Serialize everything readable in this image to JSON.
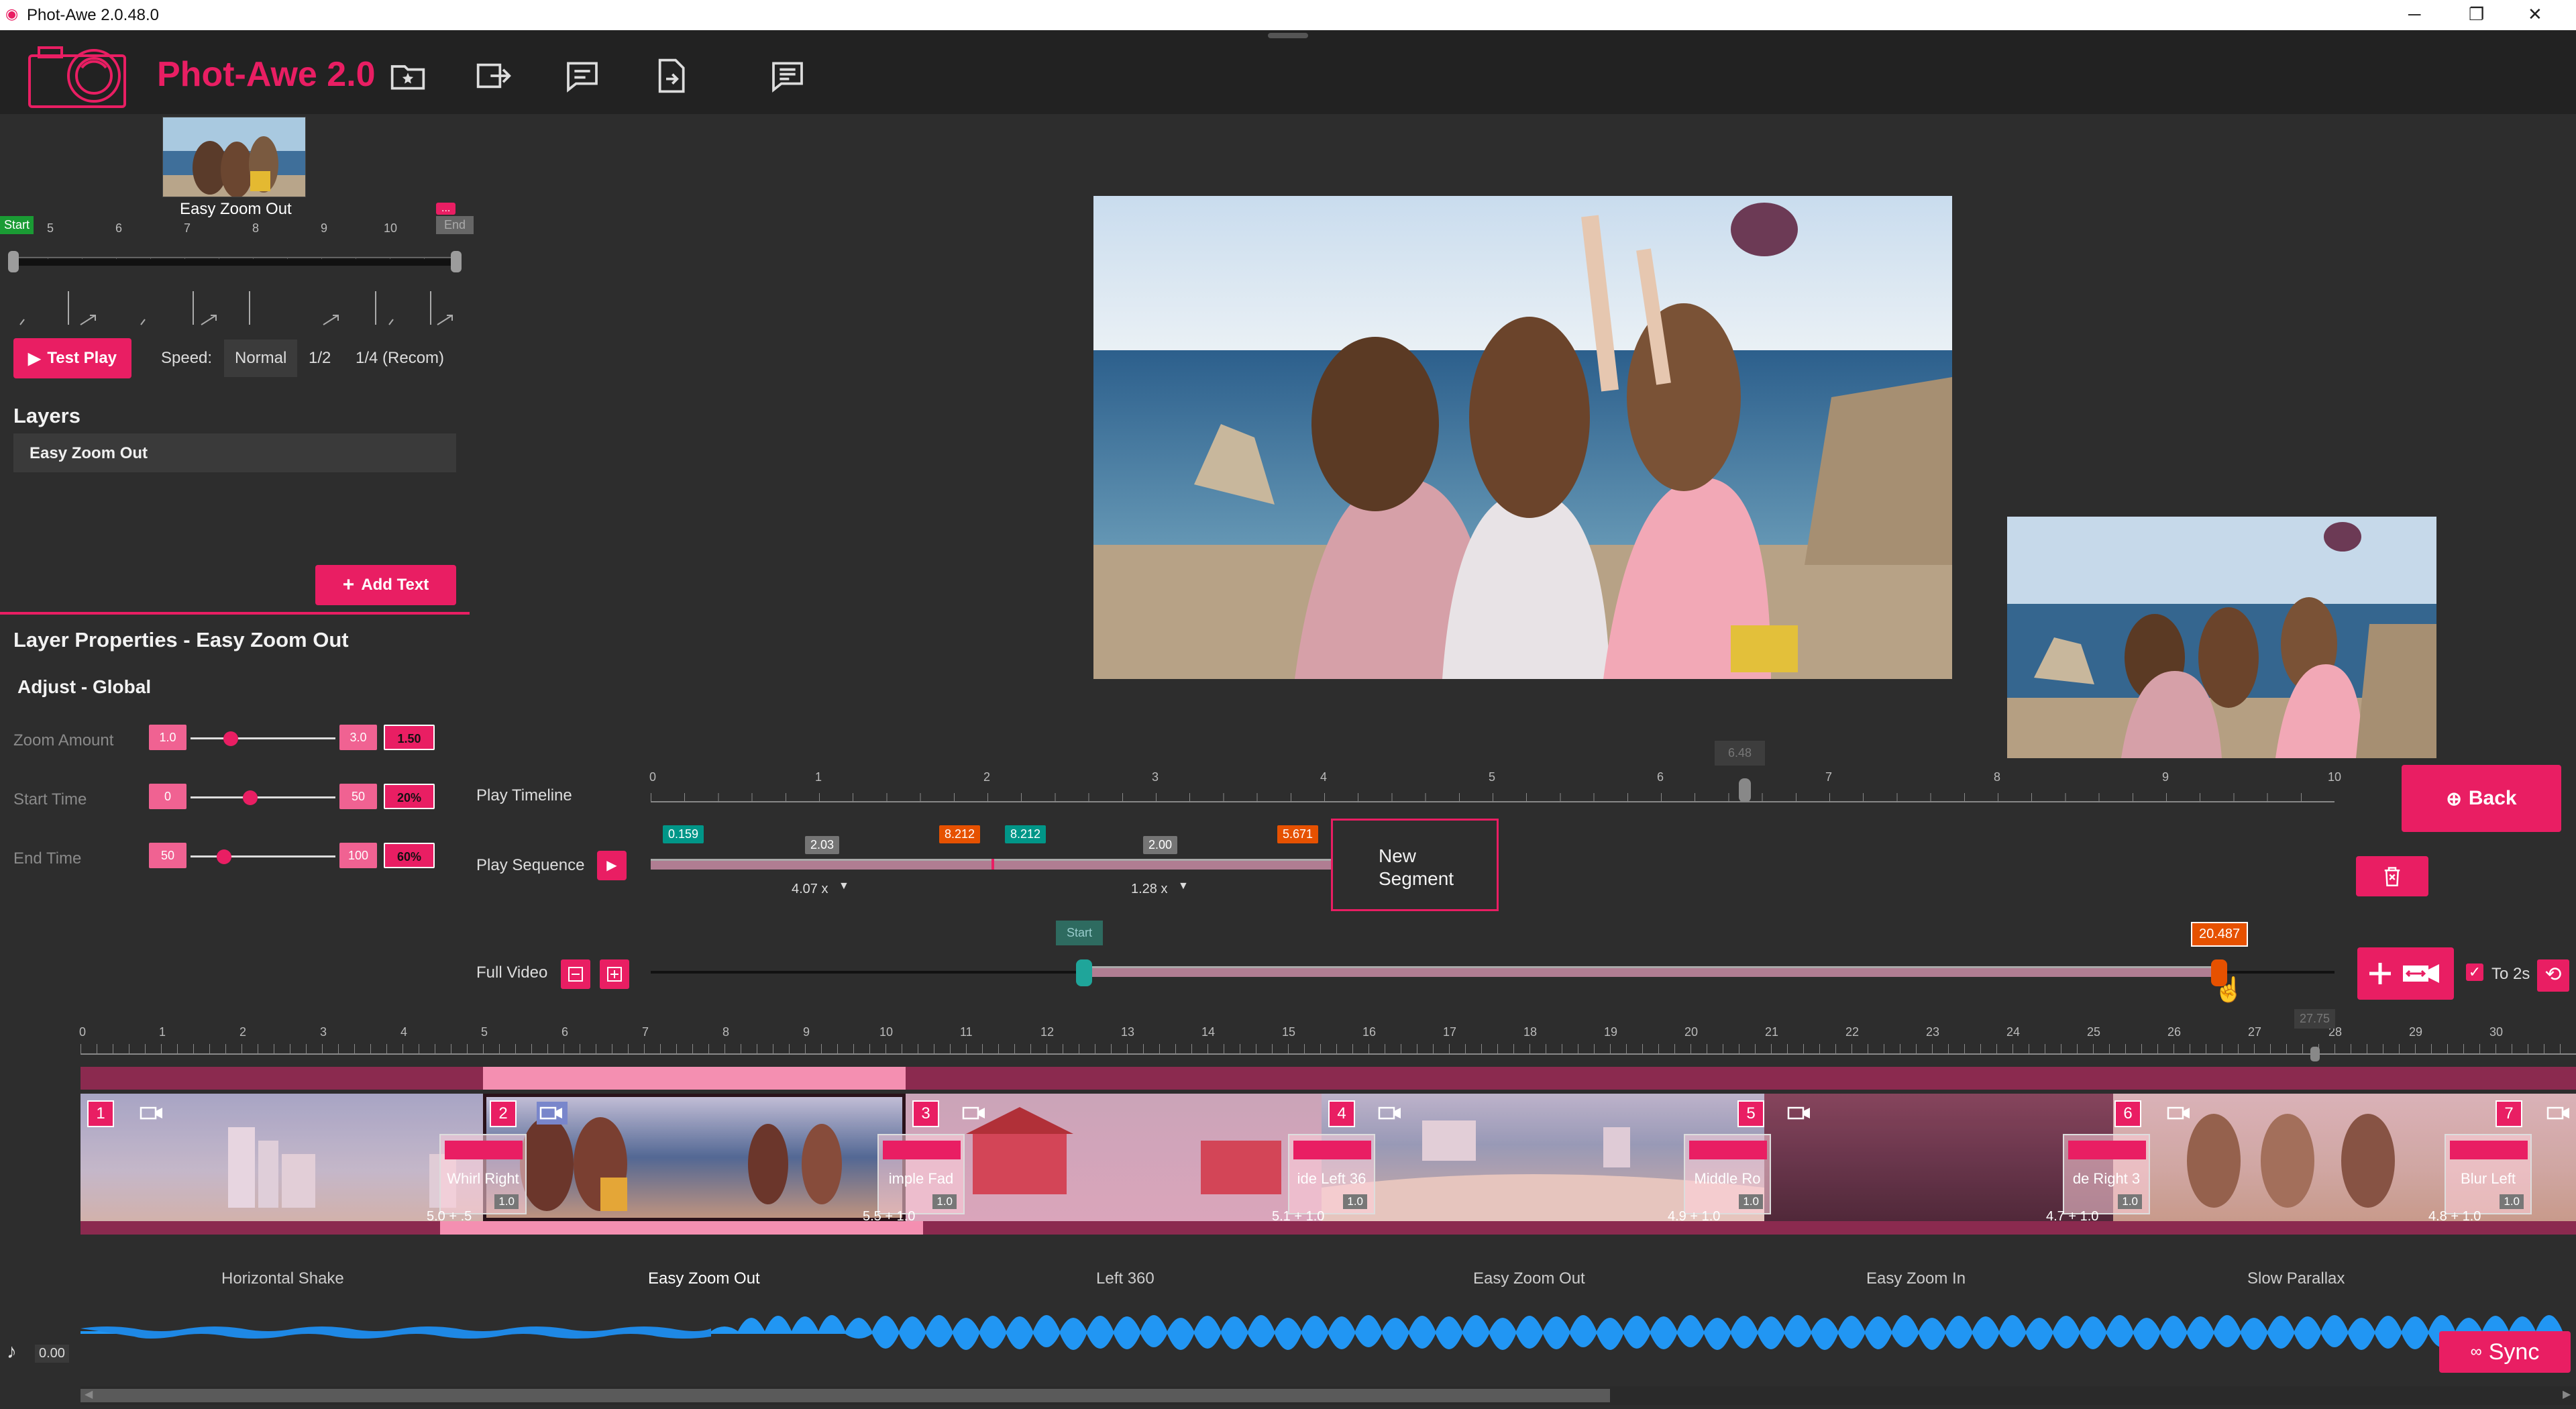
{
  "window": {
    "title": "Phot-Awe 2.0.48.0",
    "minimize": "─",
    "maximize": "❐",
    "close": "✕"
  },
  "app": {
    "title": "Phot-Awe 2.0",
    "brand_color": "#e91e63"
  },
  "header_icons": [
    "favorites-folder-icon",
    "export-icon",
    "comment-icon",
    "export-file-icon",
    "notes-icon"
  ],
  "layer_preview": {
    "thumb_label": "Easy Zoom Out",
    "start_label": "Start",
    "end_label": "End",
    "menu_label": "...",
    "scale_ticks": [
      "5",
      "6",
      "7",
      "8",
      "9",
      "10"
    ]
  },
  "playback": {
    "test_play": "Test Play",
    "speed_label": "Speed:",
    "speed_options": [
      "Normal",
      "1/2",
      "1/4 (Recom)"
    ],
    "selected_speed": "Normal"
  },
  "layers": {
    "heading": "Layers",
    "items": [
      "Easy Zoom Out"
    ],
    "add_text": "Add Text"
  },
  "properties": {
    "heading": "Layer Properties - Easy Zoom Out",
    "subheading": "Adjust - Global",
    "rows": [
      {
        "label": "Zoom Amount",
        "min": "1.0",
        "max": "3.0",
        "value": "1.50",
        "level": 0.25
      },
      {
        "label": "Start Time",
        "min": "0",
        "max": "50",
        "value": "20%",
        "level": 0.4
      },
      {
        "label": "End Time",
        "min": "50",
        "max": "100",
        "value": "60%",
        "level": 0.2
      }
    ]
  },
  "play_timeline": {
    "label": "Play Timeline",
    "ticks": [
      "0",
      "1",
      "2",
      "3",
      "4",
      "5",
      "6",
      "7",
      "8",
      "9",
      "10"
    ],
    "marker_value": "6.48",
    "position": 6.48
  },
  "play_sequence": {
    "label": "Play Sequence",
    "tags": [
      {
        "text": "0.159",
        "color": "#009688"
      },
      {
        "text": "2.03",
        "color": "#757575"
      },
      {
        "text": "8.212",
        "color": "#e65100"
      },
      {
        "text": "8.212",
        "color": "#009688"
      },
      {
        "text": "2.00",
        "color": "#757575"
      },
      {
        "text": "5.671",
        "color": "#e65100"
      }
    ],
    "speed_a": "4.07 x",
    "speed_b": "1.28 x",
    "new_segment": "New Segment"
  },
  "buttons": {
    "back": "Back"
  },
  "full_video": {
    "label": "Full Video",
    "start_label": "Start",
    "end_value": "20.487",
    "hover_value": "27.75",
    "to2s_label": "To 2s",
    "to2s_checked": true,
    "range_start": 12.5,
    "range_end": 26.7
  },
  "ruler": {
    "ticks": [
      "0",
      "1",
      "2",
      "3",
      "4",
      "5",
      "6",
      "7",
      "8",
      "9",
      "10",
      "11",
      "12",
      "13",
      "14",
      "15",
      "16",
      "17",
      "18",
      "19",
      "20",
      "21",
      "22",
      "23",
      "24",
      "25",
      "26",
      "27",
      "28",
      "29",
      "30"
    ]
  },
  "clips": [
    {
      "num": "1",
      "label": "Horizontal Shake",
      "transition": "Whirl Right",
      "tv": "1.0",
      "duration": "5.0 + .5"
    },
    {
      "num": "2",
      "label": "Easy Zoom Out",
      "transition": "imple Fad",
      "tv": "1.0",
      "duration": "5.5 + 1.0"
    },
    {
      "num": "3",
      "label": "Left 360",
      "transition": "ide Left 36",
      "tv": "1.0",
      "duration": "5.1 + 1.0"
    },
    {
      "num": "4",
      "label": "Easy Zoom Out",
      "transition": "Middle Ro",
      "tv": "1.0",
      "duration": "4.9 + 1.0"
    },
    {
      "num": "5",
      "label": "Easy Zoom In",
      "transition": "de Right 3",
      "tv": "1.0",
      "duration": "4.7 + 1.0"
    },
    {
      "num": "6",
      "label": "Slow Parallax",
      "transition": "Blur Left",
      "tv": "1.0",
      "duration": "4.8 + 1.0"
    },
    {
      "num": "7",
      "label": "",
      "transition": "",
      "tv": "",
      "duration": ""
    }
  ],
  "audio": {
    "time": "0.00",
    "sync": "Sync"
  }
}
